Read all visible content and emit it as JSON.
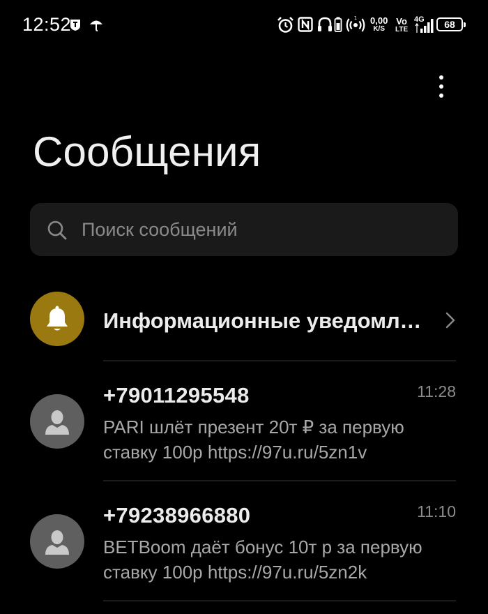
{
  "status_bar": {
    "time": "12:52",
    "net_speed_value": "0,00",
    "net_speed_unit": "K/S",
    "volte_top": "Vo",
    "volte_bottom": "LTE",
    "network_type": "4G",
    "battery_level": "68",
    "icons": [
      "tele2-icon",
      "umbrella-icon",
      "alarm-icon",
      "nfc-icon",
      "headphones-icon",
      "battery-saver-icon",
      "hotspot-icon",
      "signal-icon"
    ]
  },
  "header": {
    "title": "Сообщения",
    "menu_icon": "more-vertical-icon"
  },
  "search": {
    "placeholder": "Поиск сообщений",
    "value": ""
  },
  "notifications": {
    "title": "Информационные уведомления",
    "icon": "bell-icon",
    "avatar_color": "#9a7a10"
  },
  "conversations": [
    {
      "sender": "+79011295548",
      "time": "11:28",
      "preview": "PARI шлёт презент 20т ₽ за первую ставку 100р https://97u.ru/5zn1v"
    },
    {
      "sender": "+79238966880",
      "time": "11:10",
      "preview": "BETBoom даёт бонус 10т р за первую ставку 100р https://97u.ru/5zn2k"
    }
  ],
  "colors": {
    "background": "#000000",
    "search_bg": "#1a1a1a",
    "avatar_grey": "#5f5f5f",
    "secondary_text": "#a8a8a8"
  }
}
